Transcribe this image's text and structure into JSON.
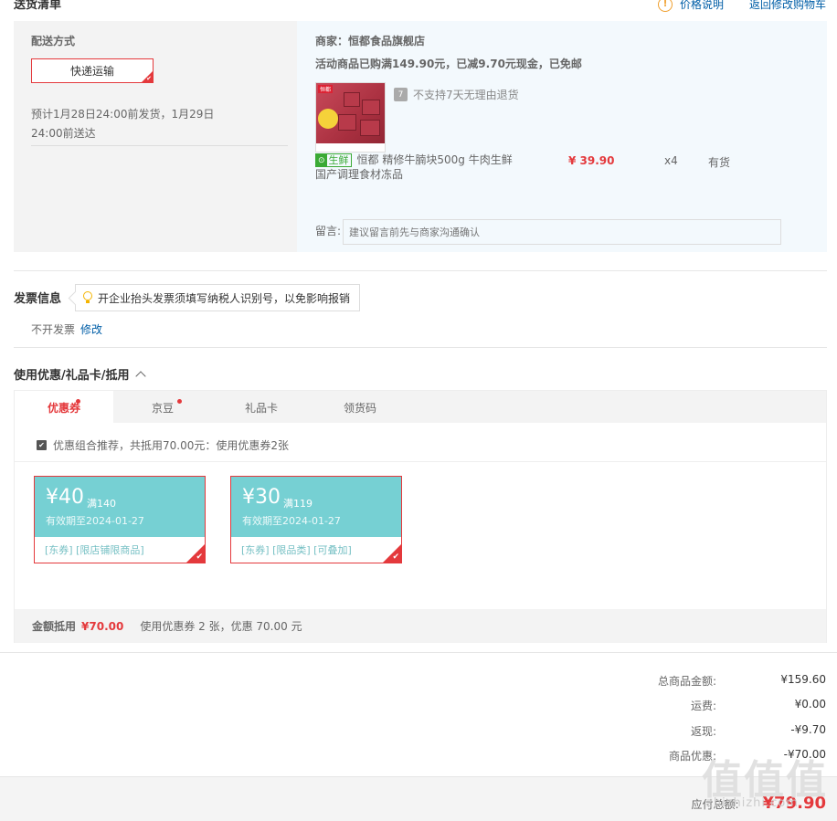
{
  "header": {
    "title": "送货清单",
    "price_note": "价格说明",
    "back_cart": "返回修改购物车"
  },
  "delivery": {
    "method_label": "配送方式",
    "method_value": "快递运输",
    "estimate_line1": "预计1月28日24:00前发货，1月29日",
    "estimate_line2": "24:00前送达"
  },
  "shop": {
    "merchant": "商家：恒都食品旗舰店",
    "promo": "活动商品已购满149.90元，已减9.70元现金，已免邮",
    "no_return": "不支持7天无理由退货",
    "seven_icon": "7",
    "fresh_label": "生鲜",
    "product_name": "恒都 精修牛腩块500g 牛肉生鲜 国产调理食材冻品",
    "price": "¥ 39.90",
    "quantity": "x4",
    "stock": "有货",
    "message_label": "留言:",
    "message_placeholder": "建议留言前先与商家沟通确认"
  },
  "invoice": {
    "title": "发票信息",
    "tip": "开企业抬头发票须填写纳税人识别号，以免影响报销",
    "value": "不开发票",
    "edit": "修改"
  },
  "coupons": {
    "title": "使用优惠/礼品卡/抵用",
    "tabs": [
      {
        "label": "优惠券"
      },
      {
        "label": "京豆"
      },
      {
        "label": "礼品卡"
      },
      {
        "label": "领货码"
      }
    ],
    "combo": "优惠组合推荐，共抵用70.00元：使用优惠券2张",
    "items": [
      {
        "amount": "¥40",
        "cond": "满140",
        "expiry": "有效期至2024-01-27",
        "tags": "[东券]  [限店铺限商品]"
      },
      {
        "amount": "¥30",
        "cond": "满119",
        "expiry": "有效期至2024-01-27",
        "tags": "[东券]  [限品类]  [可叠加]"
      }
    ],
    "footer_label": "金额抵用",
    "footer_value": "¥70.00",
    "footer_desc": "使用优惠券 2 张，优惠 70.00 元"
  },
  "totals": [
    {
      "label": "总商品金额:",
      "value": "¥159.60"
    },
    {
      "label": "运费:",
      "value": "¥0.00"
    },
    {
      "label": "返现:",
      "value": "-¥9.70"
    },
    {
      "label": "商品优惠:",
      "value": "-¥70.00"
    }
  ],
  "pay": {
    "label": "应付总额:",
    "value": "¥79.90"
  },
  "watermark": {
    "main": "值值值",
    "sub": "zhizhizhi.com"
  },
  "colors": {
    "accent_red": "#e4393c",
    "link_blue": "#005ea7",
    "coupon_teal": "#76d0d3",
    "panel_blue": "#f3f9fd"
  }
}
